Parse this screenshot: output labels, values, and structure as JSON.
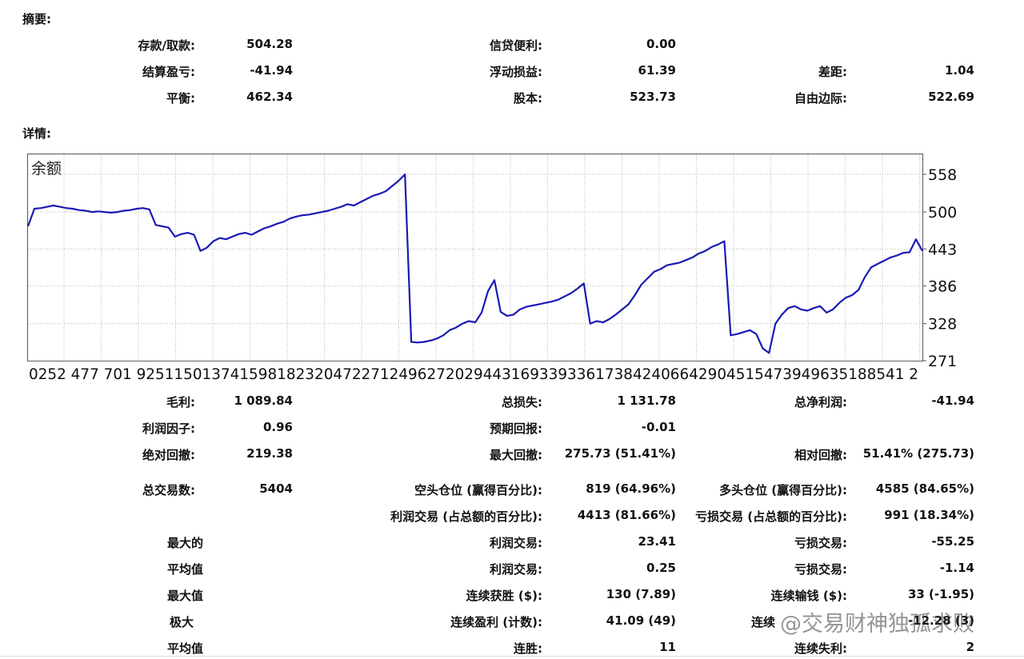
{
  "summary": {
    "heading": "摘要:",
    "deposit_label": "存款/取款:",
    "deposit_value": "504.28",
    "credit_label": "信贷便利:",
    "credit_value": "0.00",
    "closed_pl_label": "结算盈亏:",
    "closed_pl_value": "-41.94",
    "floating_pl_label": "浮动损益:",
    "floating_pl_value": "61.39",
    "spread_label": "差距:",
    "spread_value": "1.04",
    "balance_label": "平衡:",
    "balance_value": "462.34",
    "equity_label": "股本:",
    "equity_value": "523.73",
    "free_margin_label": "自由边际:",
    "free_margin_value": "522.69"
  },
  "details": {
    "heading": "详情:"
  },
  "chart_data": {
    "type": "line",
    "title": "余额",
    "y_ticks": [
      "558",
      "500",
      "443",
      "386",
      "328",
      "271"
    ],
    "ylim": [
      271,
      558
    ],
    "x_tick_text": "0252 477 701 9251150137415981823204722712496272029443169339336173842406642904515473949635188541 2",
    "grid": true,
    "series": [
      {
        "color": "#1a1ab4",
        "values": [
          478,
          505,
          506,
          508,
          510,
          508,
          506,
          505,
          503,
          502,
          500,
          501,
          500,
          499,
          500,
          502,
          503,
          505,
          506,
          504,
          480,
          478,
          476,
          462,
          466,
          468,
          465,
          440,
          445,
          455,
          460,
          458,
          462,
          466,
          468,
          465,
          470,
          475,
          478,
          482,
          485,
          490,
          493,
          495,
          496,
          498,
          500,
          502,
          505,
          508,
          512,
          510,
          515,
          520,
          525,
          528,
          532,
          540,
          548,
          558,
          300,
          299,
          300,
          302,
          305,
          310,
          318,
          322,
          328,
          332,
          330,
          345,
          378,
          395,
          346,
          340,
          342,
          350,
          354,
          356,
          358,
          360,
          362,
          365,
          370,
          375,
          382,
          390,
          328,
          332,
          330,
          335,
          342,
          350,
          358,
          372,
          388,
          398,
          408,
          412,
          418,
          420,
          422,
          426,
          430,
          436,
          440,
          446,
          450,
          455,
          310,
          312,
          315,
          318,
          312,
          290,
          283,
          328,
          342,
          352,
          355,
          350,
          348,
          352,
          355,
          345,
          350,
          360,
          368,
          372,
          380,
          400,
          415,
          420,
          425,
          430,
          433,
          437,
          438,
          458,
          440
        ]
      }
    ]
  },
  "stats": {
    "gross_profit_label": "毛利:",
    "gross_profit_value": "1 089.84",
    "gross_loss_label": "总损失:",
    "gross_loss_value": "1 131.78",
    "net_profit_label": "总净利润:",
    "net_profit_value": "-41.94",
    "profit_factor_label": "利润因子:",
    "profit_factor_value": "0.96",
    "expected_payoff_label": "预期回报:",
    "expected_payoff_value": "-0.01",
    "abs_drawdown_label": "绝对回撤:",
    "abs_drawdown_value": "219.38",
    "max_drawdown_label": "最大回撤:",
    "max_drawdown_value": "275.73 (51.41%)",
    "rel_drawdown_label": "相对回撤:",
    "rel_drawdown_value": "51.41% (275.73)",
    "total_trades_label": "总交易数:",
    "total_trades_value": "5404",
    "short_label": "空头仓位 (赢得百分比):",
    "short_value": "819 (64.96%)",
    "long_label": "多头仓位 (赢得百分比):",
    "long_value": "4585 (84.65%)",
    "profit_trades_label": "利润交易 (占总额的百分比):",
    "profit_trades_value": "4413 (81.66%)",
    "loss_trades_label": "亏损交易 (占总额的百分比):",
    "loss_trades_value": "991 (18.34%)",
    "largest_label": "最大的",
    "largest_profit_label": "利润交易:",
    "largest_profit_value": "23.41",
    "largest_loss_label": "亏损交易:",
    "largest_loss_value": "-55.25",
    "average_label": "平均值",
    "avg_profit_label": "利润交易:",
    "avg_profit_value": "0.25",
    "avg_loss_label": "亏损交易:",
    "avg_loss_value": "-1.14",
    "maximum_label": "最大值",
    "max_consec_wins_label": "连续获胜 ($):",
    "max_consec_wins_value": "130 (7.89)",
    "max_consec_losses_label": "连续输钱 ($):",
    "max_consec_losses_value": "33 (-1.95)",
    "maximal_label": "极大",
    "maximal_consec_profit_label": "连续盈利 (计数):",
    "maximal_consec_profit_value": "41.09 (49)",
    "maximal_consec_loss_label": "连续",
    "maximal_consec_loss_value": "-12.28 (3)",
    "average2_label": "平均值",
    "avg_consec_wins_label": "连胜:",
    "avg_consec_wins_value": "11",
    "avg_consec_losses_label": "连续失利:",
    "avg_consec_losses_value": "2"
  },
  "watermark": "@交易财神独孤求败"
}
